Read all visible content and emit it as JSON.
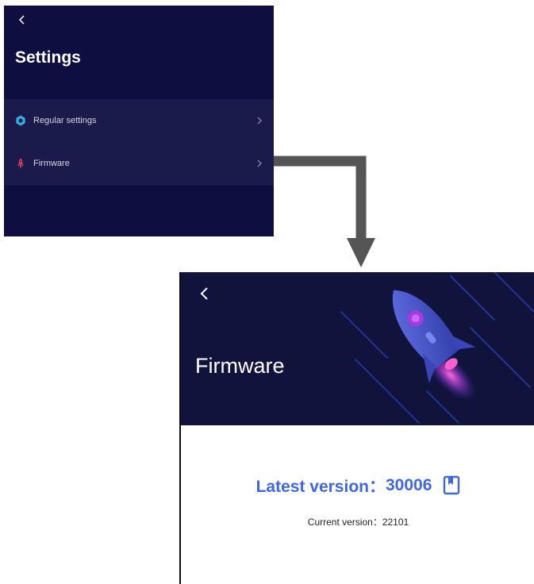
{
  "settings": {
    "title": "Settings",
    "items": [
      {
        "label": "Regular settings",
        "icon": "gear-icon"
      },
      {
        "label": "Firmware",
        "icon": "rocket-icon"
      }
    ]
  },
  "firmware": {
    "title": "Firmware",
    "latest_label": "Latest version：",
    "latest_value": "30006",
    "current_label": "Current version：",
    "current_value": "22101"
  },
  "colors": {
    "panel_bg": "#0e0e40",
    "list_bg": "#1a1a4b",
    "accent_blue": "#3f67e0",
    "gear_icon": "#33b2e8",
    "rocket_icon": "#ee3b5a"
  }
}
